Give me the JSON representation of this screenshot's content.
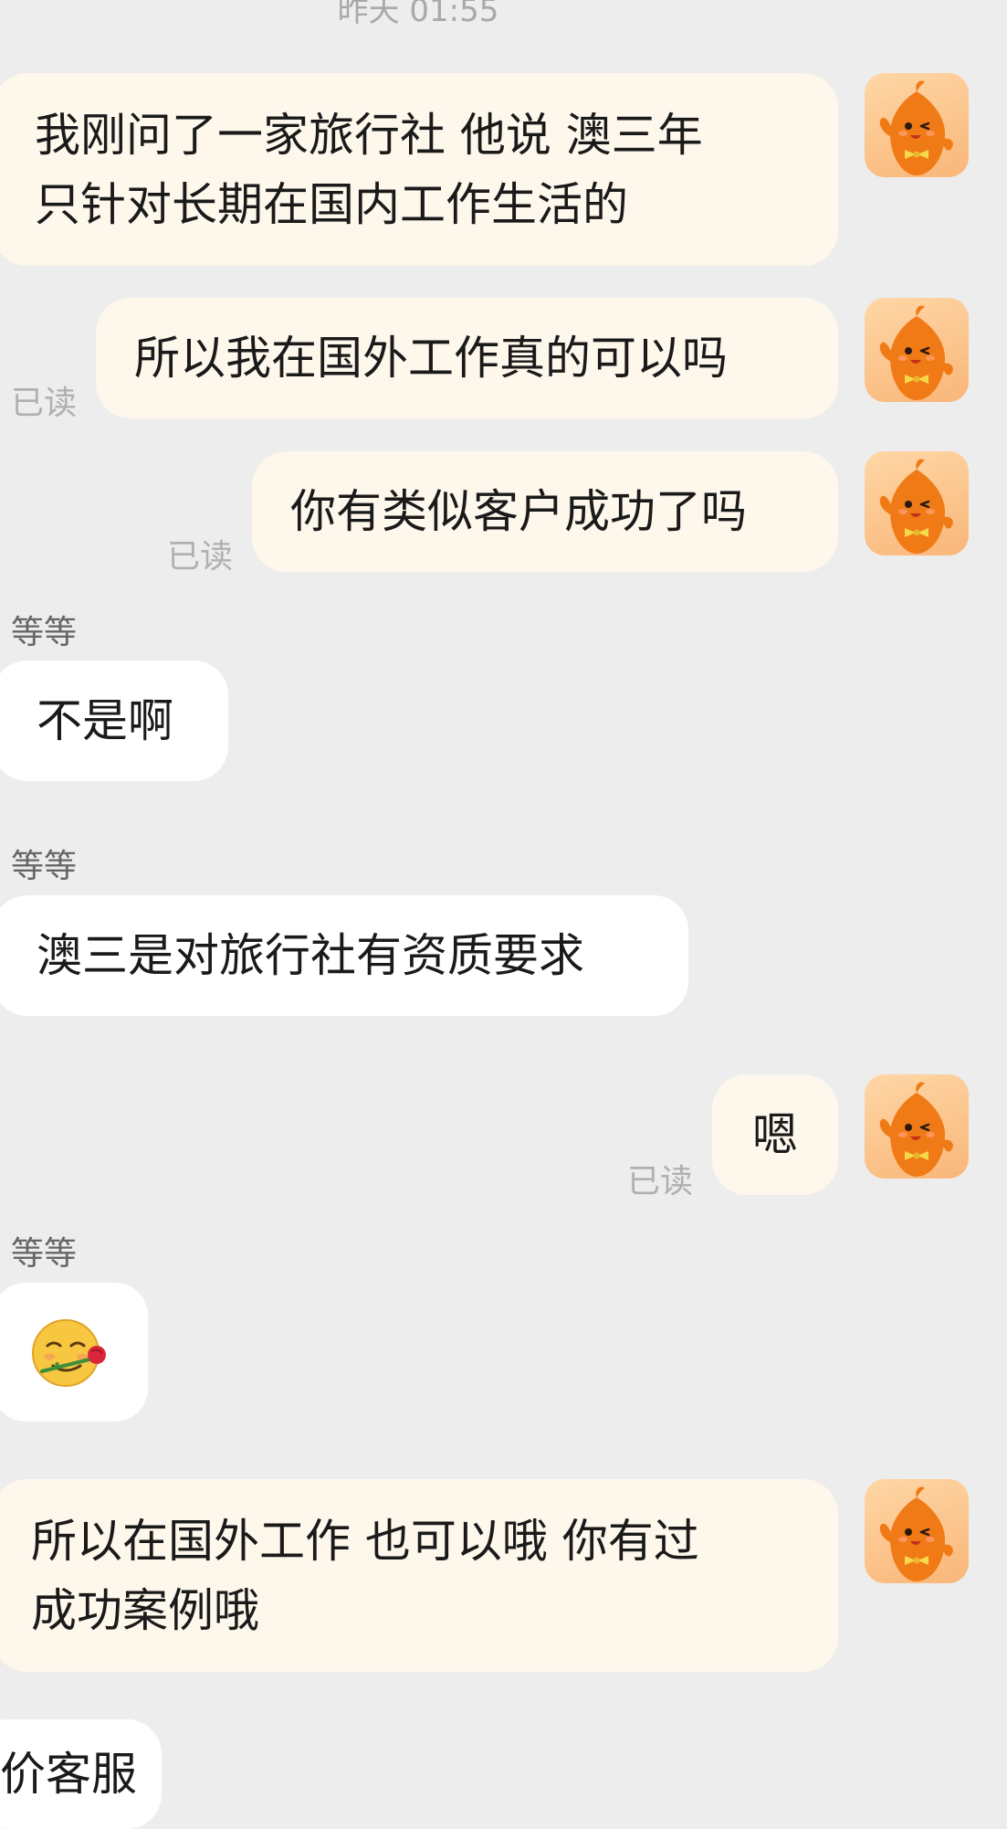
{
  "chat": {
    "timestamp": "昨天 01:55",
    "read_label": "已读",
    "peer_name": "等等",
    "messages": [
      {
        "text_line1": "我刚问了一家旅行社 他说 澳三年",
        "text_line2": "只针对长期在国内工作生活的"
      },
      {
        "text": "所以我在国外工作真的可以吗"
      },
      {
        "text": "你有类似客户成功了吗"
      },
      {
        "text": "不是啊"
      },
      {
        "text": "澳三是对旅行社有资质要求"
      },
      {
        "text": "嗯"
      },
      {
        "emoji": "rose-in-mouth-emoji"
      },
      {
        "text_line1": "所以在国外工作 也可以哦 你有过",
        "text_line2": "成功案例哦"
      },
      {
        "text": "价客服"
      }
    ]
  },
  "colors": {
    "background": "#ededed",
    "sent_bubble": "#fdf7ec",
    "received_bubble": "#ffffff",
    "avatar_orange": "#f07a16"
  },
  "icons": {
    "avatar": "orange-mascot-avatar-icon"
  }
}
